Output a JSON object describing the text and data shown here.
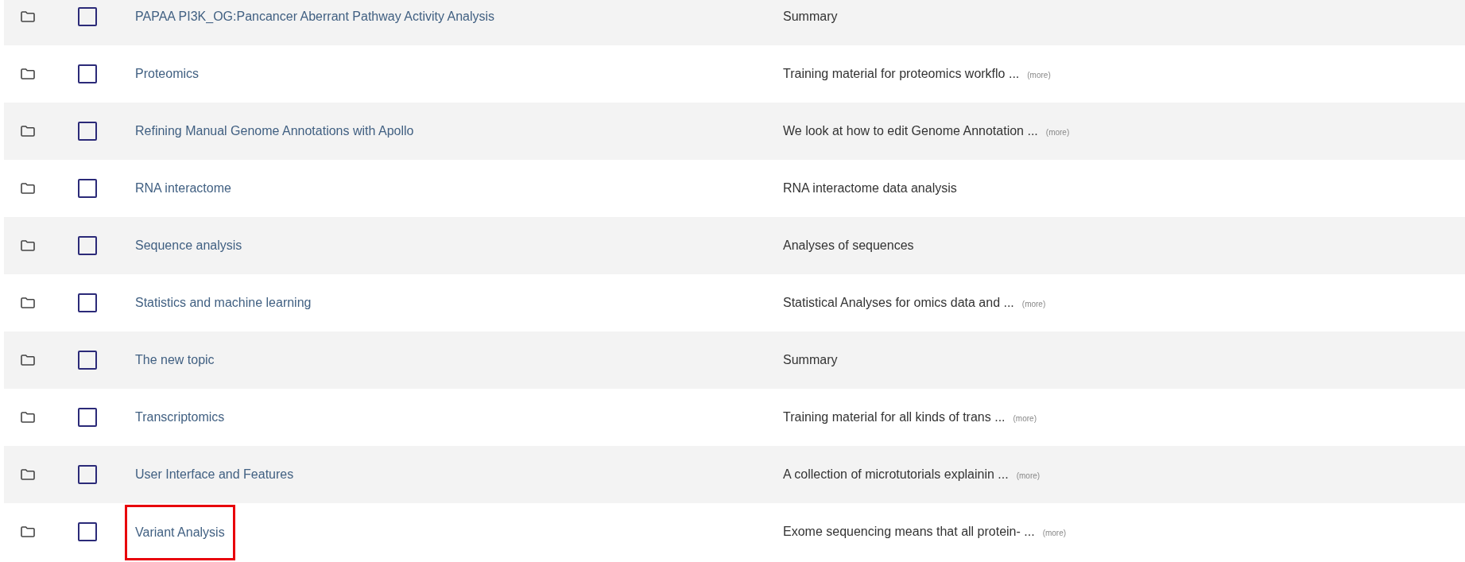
{
  "rows": [
    {
      "name": "PAPAA PI3K_OG:Pancancer Aberrant Pathway Activity Analysis",
      "checked": false,
      "highlighted": false,
      "description": "Summary"
    },
    {
      "name": "Proteomics",
      "checked": false,
      "highlighted": false,
      "description": "Training material for proteomics workflo ...",
      "more": "(more)"
    },
    {
      "name": "Refining Manual Genome Annotations with Apollo",
      "checked": false,
      "highlighted": false,
      "description": "We look at how to edit Genome Annotation ...",
      "more": "(more)"
    },
    {
      "name": "RNA interactome",
      "checked": false,
      "highlighted": false,
      "description": "RNA interactome data analysis"
    },
    {
      "name": "Sequence analysis",
      "checked": false,
      "highlighted": false,
      "description": "Analyses of sequences"
    },
    {
      "name": "Statistics and machine learning",
      "checked": false,
      "highlighted": false,
      "description": "Statistical Analyses for omics data and ...",
      "more": "(more)"
    },
    {
      "name": "The new topic",
      "checked": false,
      "highlighted": false,
      "description": "Summary"
    },
    {
      "name": "Transcriptomics",
      "checked": false,
      "highlighted": false,
      "description": "Training material for all kinds of trans ...",
      "more": "(more)"
    },
    {
      "name": "User Interface and Features",
      "checked": false,
      "highlighted": false,
      "description": "A collection of microtutorials explainin ...",
      "more": "(more)"
    },
    {
      "name": "Variant Analysis",
      "checked": false,
      "highlighted": true,
      "description": "Exome sequencing means that all protein- ...",
      "more": "(more)"
    }
  ]
}
